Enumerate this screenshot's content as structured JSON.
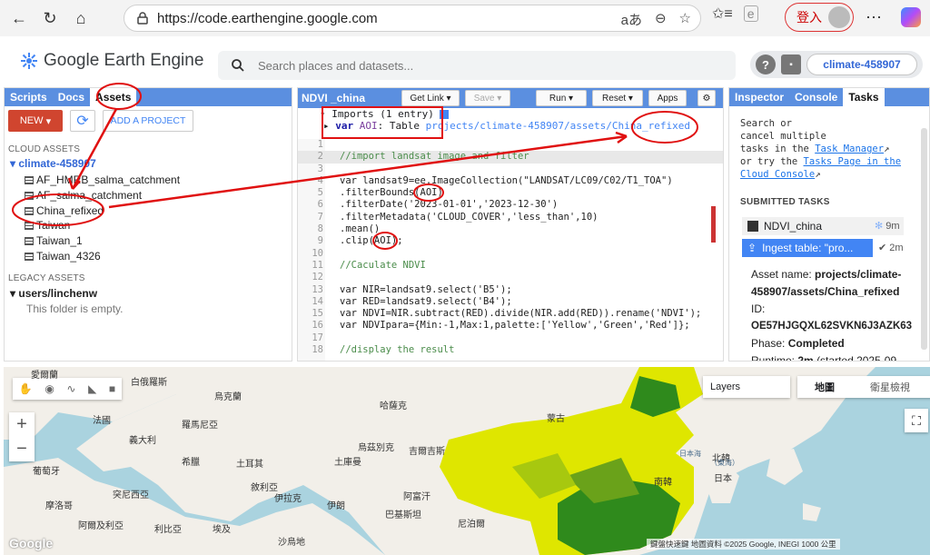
{
  "browser": {
    "url": "https://code.earthengine.google.com",
    "login_label": "登入"
  },
  "header": {
    "logo_text": "Google Earth Engine",
    "search_placeholder": "Search places and datasets...",
    "help_icon": "?",
    "project": "climate-458907"
  },
  "left_panel": {
    "tabs": [
      "Scripts",
      "Docs",
      "Assets"
    ],
    "active_tab": "Assets",
    "new_label": "NEW",
    "add_project_label": "ADD A PROJECT",
    "cloud_assets_label": "CLOUD ASSETS",
    "cloud_root": "climate-458907",
    "cloud_items": [
      "AF_HMRB_salma_catchment",
      "AF_salma_catchment",
      "China_refixed",
      "Taiwan",
      "Taiwan_1",
      "Taiwan_4326"
    ],
    "legacy_label": "LEGACY ASSETS",
    "legacy_root": "users/linchenw",
    "legacy_empty": "This folder is empty."
  },
  "editor": {
    "script_name": "NDVI _china",
    "get_link": "Get Link",
    "save": "Save",
    "run": "Run",
    "reset": "Reset",
    "apps": "Apps",
    "imports_header": "Imports (1 entry)",
    "import_var": "var",
    "import_name": "AOI",
    "import_type": "Table",
    "import_path": "projects/climate-458907/assets/China_refixed",
    "lines": [
      {
        "n": "1",
        "text": ""
      },
      {
        "n": "2",
        "text": "//import landsat image and filter"
      },
      {
        "n": "3",
        "text": ""
      },
      {
        "n": "4",
        "text": "var landsat9=ee.ImageCollection(\"LANDSAT/LC09/C02/T1_TOA\")"
      },
      {
        "n": "5",
        "text": ".filterBounds(AOI)"
      },
      {
        "n": "6",
        "text": ".filterDate('2023-01-01','2023-12-30')"
      },
      {
        "n": "7",
        "text": ".filterMetadata('CLOUD_COVER','less_than',10)"
      },
      {
        "n": "8",
        "text": ".mean()"
      },
      {
        "n": "9",
        "text": ".clip(AOI);"
      },
      {
        "n": "10",
        "text": ""
      },
      {
        "n": "11",
        "text": "//Caculate NDVI"
      },
      {
        "n": "12",
        "text": ""
      },
      {
        "n": "13",
        "text": "var NIR=landsat9.select('B5');"
      },
      {
        "n": "14",
        "text": "var RED=landsat9.select('B4');"
      },
      {
        "n": "15",
        "text": "var NDVI=NIR.subtract(RED).divide(NIR.add(RED)).rename('NDVI');"
      },
      {
        "n": "16",
        "text": "var NDVIpara={Min:-1,Max:1,palette:['Yellow','Green','Red']};"
      },
      {
        "n": "17",
        "text": ""
      },
      {
        "n": "18",
        "text": "//display the result"
      }
    ]
  },
  "right_panel": {
    "tabs": [
      "Inspector",
      "Console",
      "Tasks"
    ],
    "active_tab": "Tasks",
    "intro_1": "Search or",
    "intro_2": "cancel multiple",
    "intro_3": "tasks in the",
    "task_manager": "Task Manager",
    "intro_4": "or try the",
    "tasks_page": "Tasks Page in the",
    "cloud_console": "Cloud Console",
    "submitted_label": "SUBMITTED TASKS",
    "task1_name": "NDVI_china",
    "task1_time": "9m",
    "task2_name": "Ingest table: \"pro...",
    "task2_time": "2m",
    "asset_name_label": "Asset name:",
    "asset_name_value": "projects/climate-458907/assets/China_refixed",
    "id_label": "ID:",
    "id_value": "OE57HJGQXL62SVKN6J3AZK63",
    "phase_label": "Phase:",
    "phase_value": "Completed",
    "runtime_label": "Runtime:",
    "runtime_value": "2m",
    "runtime_rest": "(started 2025-09-"
  },
  "map": {
    "layers_label": "Layers",
    "map_btn": "地圖",
    "sat_btn": "衛星檢視",
    "zoom_in": "+",
    "zoom_out": "−",
    "footer": "鍵盤快速鍵  地圖資料 ©2025 Google, INEGI  1000 公里",
    "logo": "Google",
    "labels": [
      {
        "t": "愛爾蘭"
      },
      {
        "t": "白俄羅斯"
      },
      {
        "t": "烏克蘭"
      },
      {
        "t": "哈薩克"
      },
      {
        "t": "蒙古"
      },
      {
        "t": "法國"
      },
      {
        "t": "羅馬尼亞"
      },
      {
        "t": "烏茲別克"
      },
      {
        "t": "義大利"
      },
      {
        "t": "土庫曼"
      },
      {
        "t": "吉爾吉斯"
      },
      {
        "t": "希臘"
      },
      {
        "t": "土耳其"
      },
      {
        "t": "敘利亞"
      },
      {
        "t": "伊拉克"
      },
      {
        "t": "伊朗"
      },
      {
        "t": "阿富汗"
      },
      {
        "t": "巴基斯坦"
      },
      {
        "t": "葡萄牙"
      },
      {
        "t": "突尼西亞"
      },
      {
        "t": "摩洛哥"
      },
      {
        "t": "阿爾及利亞"
      },
      {
        "t": "利比亞"
      },
      {
        "t": "埃及"
      },
      {
        "t": "沙烏地"
      },
      {
        "t": "北韓"
      },
      {
        "t": "南韓"
      },
      {
        "t": "日本"
      },
      {
        "t": "日本海"
      },
      {
        "t": "（東海）"
      },
      {
        "t": "尼泊爾"
      }
    ]
  }
}
